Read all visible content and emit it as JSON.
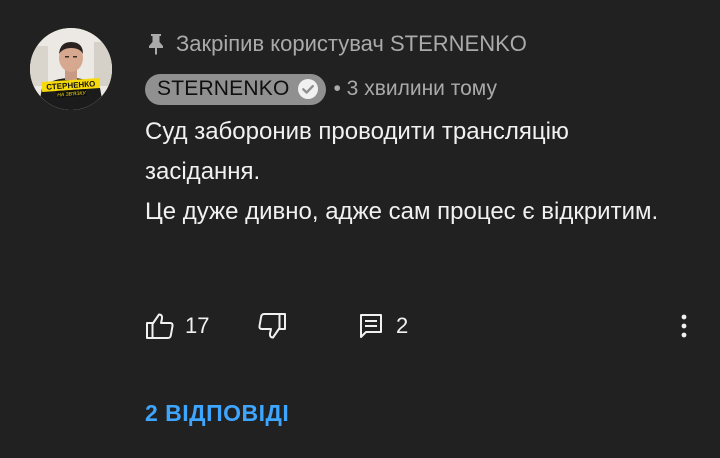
{
  "pinned": {
    "text": "Закріпив користувач STERNENKO",
    "icon": "pin-icon"
  },
  "author": {
    "name": "STERNENKO",
    "verified_icon": "verified-check-icon",
    "meta": "• 3 хвилини тому",
    "avatar_label_top": "СТЕРНЕНКО",
    "avatar_label_bottom": "НА ЗВ'ЯЗКУ"
  },
  "comment": {
    "lines": [
      "Суд заборонив проводити трансляцію засідання.",
      "Це дуже дивно, адже сам процес є відкритим."
    ]
  },
  "actions": {
    "like_icon": "thumbs-up-icon",
    "like_count": "17",
    "dislike_icon": "thumbs-down-icon",
    "reply_icon": "reply-icon",
    "reply_count": "2",
    "more_icon": "more-vert-icon"
  },
  "replies_link": "2 ВІДПОВІДІ",
  "colors": {
    "background": "#212121",
    "primary_text": "#f1f1f1",
    "secondary_text": "#aaaaaa",
    "author_chip": "#909090",
    "link": "#3ea6ff",
    "avatar_badge": "#f5d90a"
  }
}
